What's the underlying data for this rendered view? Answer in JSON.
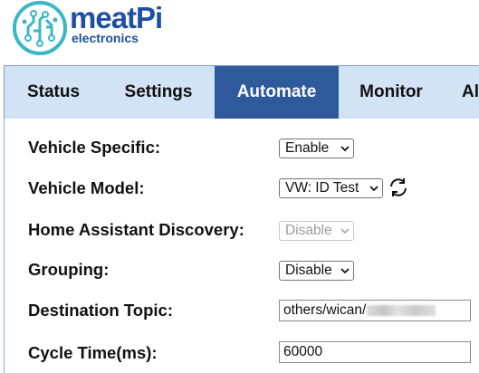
{
  "brand": {
    "name": "meatPi",
    "tagline": "electronics",
    "color": "#1e4fa3",
    "mark_color": "#3bb6c9",
    "logo_icon": "circuit-brain-icon"
  },
  "tabs": [
    {
      "label": "Status"
    },
    {
      "label": "Settings"
    },
    {
      "label": "Automate",
      "active": true
    },
    {
      "label": "Monitor"
    },
    {
      "label": "Al"
    }
  ],
  "colors": {
    "tab_bar_bg": "#d3e3f6",
    "tab_active_bg": "#2e5a9c",
    "tab_active_text": "#ffffff"
  },
  "form": {
    "vehicle_specific": {
      "label": "Vehicle Specific:",
      "value": "Enable"
    },
    "vehicle_model": {
      "label": "Vehicle Model:",
      "value": "VW: ID Test",
      "refresh_icon": "refresh-icon"
    },
    "ha_discovery": {
      "label": "Home Assistant Discovery:",
      "value": "Disable",
      "disabled": true
    },
    "grouping": {
      "label": "Grouping:",
      "value": "Disable"
    },
    "destination_topic": {
      "label": "Destination Topic:",
      "value": "others/wican/",
      "redacted_suffix": true
    },
    "cycle_time": {
      "label": "Cycle Time(ms):",
      "value": "60000"
    }
  }
}
